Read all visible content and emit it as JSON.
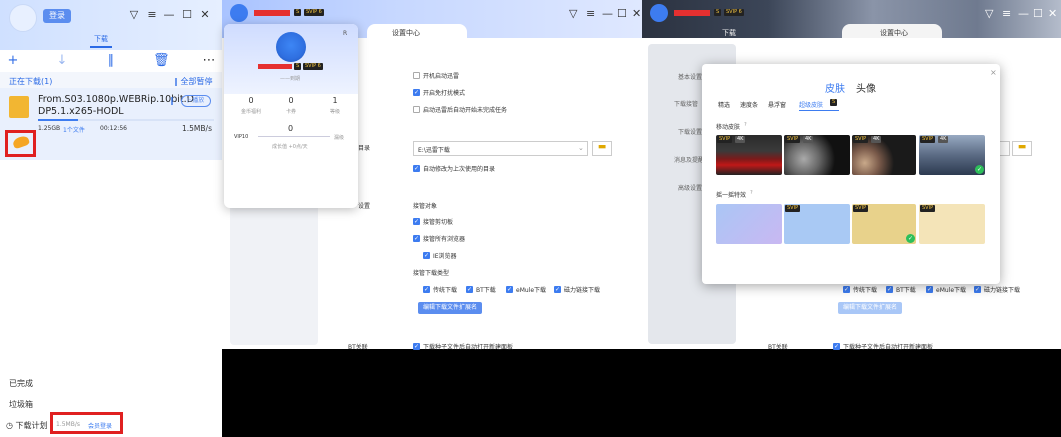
{
  "panel1": {
    "login_label": "登录",
    "tab_download": "下载",
    "section_title": "正在下载(1)",
    "pause_all": "全部暂停",
    "file_name_line1": "From.S03.1080p.WEBRip.10bit.D",
    "file_name_line2": "DP5.1.x265-HODL",
    "play_label": "播放",
    "file_size": "1.25GB",
    "file_count": "1个文件",
    "time_left": "00:12:56",
    "speed": "1.5MB/s",
    "completed": "已完成",
    "trash": "垃圾箱",
    "plan": "下载计划",
    "bottom_speed": "1.5MB/s",
    "member_login": "会员登录"
  },
  "panel2": {
    "settings_center": "设置中心",
    "profile_rank": "——到期",
    "stats": [
      {
        "value": "0",
        "label": "金币福利"
      },
      {
        "value": "0",
        "label": "卡券"
      },
      {
        "value": "1",
        "label": "等级"
      }
    ],
    "vip_label": "VIP10",
    "vip_value": "0",
    "vip_right": "漏级",
    "growth": "成长值 +0点/天",
    "badge_s": "S",
    "badge_vip": "SVIP 6",
    "close_x": "R",
    "opt_startup": "开机启动迅雷",
    "opt_silent": "开启免打扰模式",
    "opt_resume": "启动迅雷后自动开始未完成任务",
    "dir_label": "目录",
    "dir_value": "E:\\迅雷下载",
    "opt_auto_dir": "自动修改为上次使用的目录",
    "takeover_label": "设置",
    "takeover_obj": "接管对象",
    "opt_clipboard": "接管剪切板",
    "opt_browsers": "接管所有浏览器",
    "opt_ie": "IE浏览器",
    "takeover_types": "接管下载类型",
    "types": [
      "传统下载",
      "BT下载",
      "eMule下载",
      "磁力链接下载"
    ],
    "edit_ext_btn": "编辑下载文件扩展名",
    "bt_label": "BT关联",
    "bt_option": "下载种子文件后自动打开新建面板"
  },
  "panel3": {
    "tab_download": "下载",
    "settings_center": "设置中心",
    "side_items": [
      "基本设置",
      "下载接管",
      "下载设置",
      "消息及提醒",
      "高级设置"
    ],
    "popup_tabs": [
      "皮肤",
      "头像"
    ],
    "sub_tabs": [
      "精选",
      "速度条",
      "悬浮窗",
      "超级皮肤"
    ],
    "sub_badge": "S",
    "dynamic_skin": "移动皮肤",
    "shake_effect": "摇一摇特效",
    "close": "×",
    "svip": "SVIP",
    "k4": "4K",
    "types": [
      "传统下载",
      "BT下载",
      "eMule下载",
      "磁力链接下载"
    ],
    "edit_ext_btn": "编辑下载文件扩展名",
    "bt_label": "BT关联",
    "bt_option": "下载种子文件后自动打开新建面板"
  },
  "colors": {
    "accent": "#3d7cf0",
    "highlight_red": "#e02020"
  }
}
